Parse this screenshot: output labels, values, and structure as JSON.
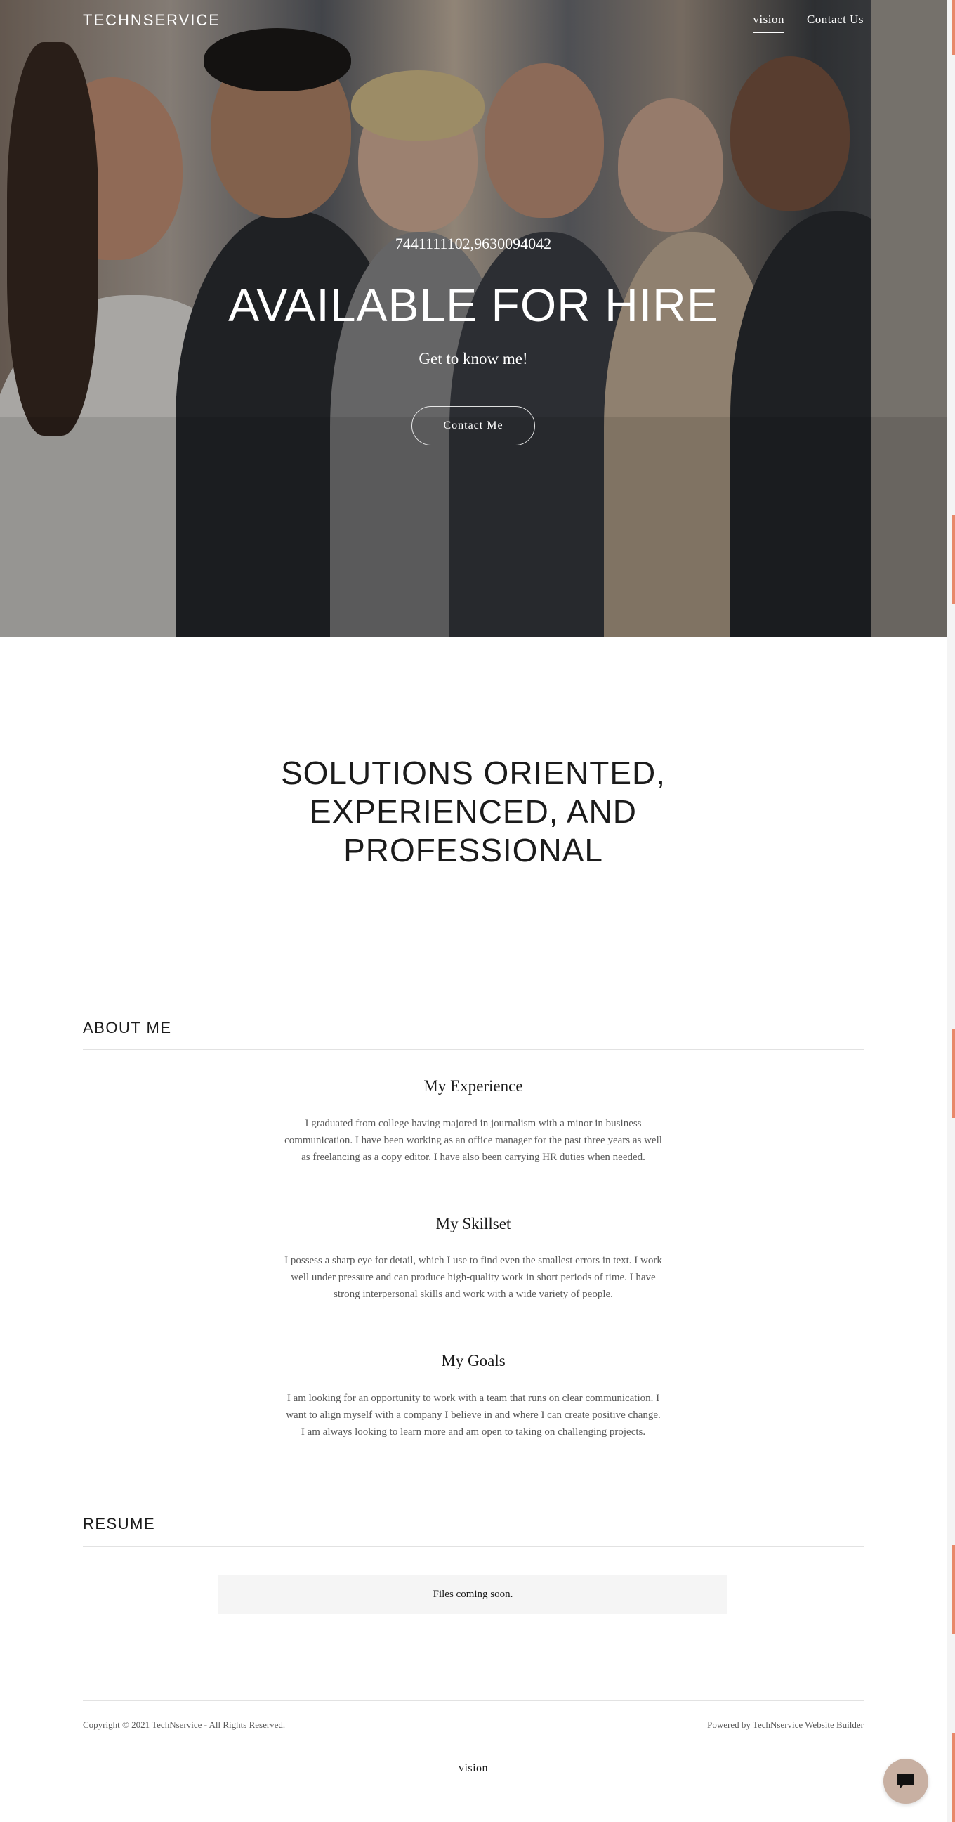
{
  "header": {
    "brand": "TECHNSERVICE",
    "nav": [
      {
        "label": "vision",
        "active": true
      },
      {
        "label": "Contact Us",
        "active": false
      }
    ]
  },
  "hero": {
    "phone": "7441111102,9630094042",
    "title": "AVAILABLE FOR HIRE",
    "subtitle": "Get to know me!",
    "button_label": "Contact Me"
  },
  "tagline": {
    "lines": [
      "SOLUTIONS ORIENTED,",
      "EXPERIENCED, AND",
      "PROFESSIONAL"
    ]
  },
  "about": {
    "title": "ABOUT ME",
    "blocks": [
      {
        "heading": "My Experience",
        "body": "I graduated from college having majored in journalism with a minor in business communication. I have been working as an office manager for the past three years as well as freelancing as a copy editor. I have also been carrying HR duties when needed."
      },
      {
        "heading": "My Skillset",
        "body": "I possess a sharp eye for detail, which I use to find even the smallest errors in text. I work well under pressure and can produce high-quality work in short periods of time. I have strong interpersonal skills and work with a wide variety of people."
      },
      {
        "heading": "My Goals",
        "body": "I am looking for an opportunity to work with a team that runs on clear communication. I want to align myself with a company I believe in and where I can create positive change. I am always looking to learn more and am open to taking on challenging projects."
      }
    ]
  },
  "resume": {
    "title": "RESUME",
    "files_text": "Files coming soon."
  },
  "footer": {
    "copyright": "Copyright © 2021 TechNservice - All Rights Reserved.",
    "powered_by": "Powered by TechNservice Website Builder",
    "link": "vision"
  },
  "chat": {
    "icon": "chat-bubble-icon"
  },
  "colors": {
    "accent": "#e8896a",
    "chat_bg": "#c8b0a2"
  }
}
